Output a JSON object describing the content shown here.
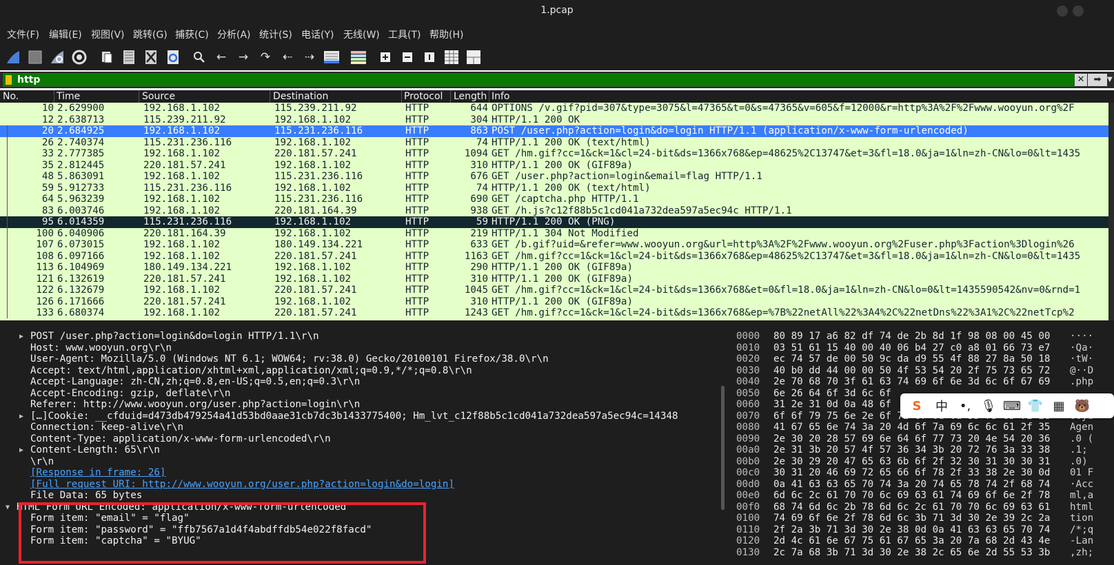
{
  "window": {
    "title": "1.pcap"
  },
  "menu": [
    "文件(F)",
    "编辑(E)",
    "视图(V)",
    "跳转(G)",
    "捕获(C)",
    "分析(A)",
    "统计(S)",
    "电话(Y)",
    "无线(W)",
    "工具(T)",
    "帮助(H)"
  ],
  "toolbar": {
    "icons": [
      "shark-fin-start-icon",
      "stop-square-icon",
      "restart-fin-icon",
      "options-gear-icon",
      "open-file-icon",
      "save-file-icon",
      "close-file-icon",
      "reload-icon",
      "search-icon",
      "back-arrow-icon",
      "forward-arrow-icon",
      "goto-packet-icon",
      "first-packet-icon",
      "last-packet-icon",
      "autoscroll-icon",
      "colorize-icon",
      "zoom-in-icon",
      "zoom-out-icon",
      "normal-size-icon",
      "resize-columns-icon",
      "layout-icon"
    ]
  },
  "filter": {
    "value": "http"
  },
  "columns": [
    "No.",
    "Time",
    "Source",
    "Destination",
    "Protocol",
    "Length",
    "Info"
  ],
  "packets": [
    {
      "no": "10",
      "time": "2.629900",
      "src": "192.168.1.102",
      "dst": "115.239.211.92",
      "proto": "HTTP",
      "len": "644",
      "info": "OPTIONS /v.gif?pid=307&type=3075&l=47365&t=0&s=47365&v=605&f=12000&r=http%3A%2F%2Fwww.wooyun.org%2F"
    },
    {
      "no": "12",
      "time": "2.638713",
      "src": "115.239.211.92",
      "dst": "192.168.1.102",
      "proto": "HTTP",
      "len": "304",
      "info": "HTTP/1.1 200 OK"
    },
    {
      "no": "20",
      "time": "2.684925",
      "src": "192.168.1.102",
      "dst": "115.231.236.116",
      "proto": "HTTP",
      "len": "863",
      "info": "POST /user.php?action=login&do=login HTTP/1.1  (application/x-www-form-urlencoded)"
    },
    {
      "no": "26",
      "time": "2.740374",
      "src": "115.231.236.116",
      "dst": "192.168.1.102",
      "proto": "HTTP",
      "len": "74",
      "info": "HTTP/1.1 200 OK  (text/html)"
    },
    {
      "no": "33",
      "time": "2.777385",
      "src": "192.168.1.102",
      "dst": "220.181.57.241",
      "proto": "HTTP",
      "len": "1094",
      "info": "GET /hm.gif?cc=1&ck=1&cl=24-bit&ds=1366x768&ep=48625%2C13747&et=3&fl=18.0&ja=1&ln=zh-CN&lo=0&lt=1435"
    },
    {
      "no": "35",
      "time": "2.812445",
      "src": "220.181.57.241",
      "dst": "192.168.1.102",
      "proto": "HTTP",
      "len": "310",
      "info": "HTTP/1.1 200 OK  (GIF89a)"
    },
    {
      "no": "48",
      "time": "5.863091",
      "src": "192.168.1.102",
      "dst": "115.231.236.116",
      "proto": "HTTP",
      "len": "676",
      "info": "GET /user.php?action=login&email=flag HTTP/1.1"
    },
    {
      "no": "59",
      "time": "5.912733",
      "src": "115.231.236.116",
      "dst": "192.168.1.102",
      "proto": "HTTP",
      "len": "74",
      "info": "HTTP/1.1 200 OK  (text/html)"
    },
    {
      "no": "64",
      "time": "5.963239",
      "src": "192.168.1.102",
      "dst": "115.231.236.116",
      "proto": "HTTP",
      "len": "690",
      "info": "GET /captcha.php HTTP/1.1"
    },
    {
      "no": "83",
      "time": "6.003746",
      "src": "192.168.1.102",
      "dst": "220.181.164.39",
      "proto": "HTTP",
      "len": "938",
      "info": "GET /h.js?c12f88b5c1cd041a732dea597a5ec94c HTTP/1.1"
    },
    {
      "no": "95",
      "time": "6.014359",
      "src": "115.231.236.116",
      "dst": "192.168.1.102",
      "proto": "HTTP",
      "len": "59",
      "info": "HTTP/1.1 200 OK  (PNG)"
    },
    {
      "no": "100",
      "time": "6.040906",
      "src": "220.181.164.39",
      "dst": "192.168.1.102",
      "proto": "HTTP",
      "len": "219",
      "info": "HTTP/1.1 304 Not Modified"
    },
    {
      "no": "107",
      "time": "6.073015",
      "src": "192.168.1.102",
      "dst": "180.149.134.221",
      "proto": "HTTP",
      "len": "633",
      "info": "GET /b.gif?uid=&refer=www.wooyun.org&url=http%3A%2F%2Fwww.wooyun.org%2Fuser.php%3Faction%3Dlogin%26"
    },
    {
      "no": "108",
      "time": "6.097166",
      "src": "192.168.1.102",
      "dst": "220.181.57.241",
      "proto": "HTTP",
      "len": "1163",
      "info": "GET /hm.gif?cc=1&ck=1&cl=24-bit&ds=1366x768&ep=48625%2C13747&et=3&fl=18.0&ja=1&ln=zh-CN&lo=0&lt=1435"
    },
    {
      "no": "113",
      "time": "6.104969",
      "src": "180.149.134.221",
      "dst": "192.168.1.102",
      "proto": "HTTP",
      "len": "290",
      "info": "HTTP/1.1 200 OK  (GIF89a)"
    },
    {
      "no": "121",
      "time": "6.132619",
      "src": "220.181.57.241",
      "dst": "192.168.1.102",
      "proto": "HTTP",
      "len": "310",
      "info": "HTTP/1.1 200 OK  (GIF89a)"
    },
    {
      "no": "122",
      "time": "6.132679",
      "src": "192.168.1.102",
      "dst": "220.181.57.241",
      "proto": "HTTP",
      "len": "1045",
      "info": "GET /hm.gif?cc=1&ck=1&cl=24-bit&ds=1366x768&et=0&fl=18.0&ja=1&ln=zh-CN&lo=0&lt=1435590542&nv=0&rnd=1"
    },
    {
      "no": "126",
      "time": "6.171666",
      "src": "220.181.57.241",
      "dst": "192.168.1.102",
      "proto": "HTTP",
      "len": "310",
      "info": "HTTP/1.1 200 OK  (GIF89a)"
    },
    {
      "no": "133",
      "time": "6.680374",
      "src": "192.168.1.102",
      "dst": "220.181.57.241",
      "proto": "HTTP",
      "len": "1243",
      "info": "GET /hm.gif?cc=1&ck=1&cl=24-bit&ds=1366x768&ep=%7B%22netAll%22%3A4%2C%22netDns%22%3A1%2C%22netTcp%2"
    }
  ],
  "selected_packet": "20",
  "details": [
    {
      "text": "POST /user.php?action=login&do=login HTTP/1.1\\r\\n",
      "expander": true,
      "link": false
    },
    {
      "text": "Host: www.wooyun.org\\r\\n",
      "expander": false,
      "link": false
    },
    {
      "text": "User-Agent: Mozilla/5.0 (Windows NT 6.1; WOW64; rv:38.0) Gecko/20100101 Firefox/38.0\\r\\n",
      "expander": false,
      "link": false
    },
    {
      "text": "Accept: text/html,application/xhtml+xml,application/xml;q=0.9,*/*;q=0.8\\r\\n",
      "expander": false,
      "link": false
    },
    {
      "text": "Accept-Language: zh-CN,zh;q=0.8,en-US;q=0.5,en;q=0.3\\r\\n",
      "expander": false,
      "link": false
    },
    {
      "text": "Accept-Encoding: gzip, deflate\\r\\n",
      "expander": false,
      "link": false
    },
    {
      "text": "Referer: http://www.wooyun.org/user.php?action=login\\r\\n",
      "expander": false,
      "link": false
    },
    {
      "text": " […]Cookie: __cfduid=d473db479254a41d53bd0aae31cb7dc3b1433775400; Hm_lvt_c12f88b5c1cd041a732dea597a5ec94c=14348",
      "expander": true,
      "link": false
    },
    {
      "text": "Connection: keep-alive\\r\\n",
      "expander": false,
      "link": false
    },
    {
      "text": "Content-Type: application/x-www-form-urlencoded\\r\\n",
      "expander": false,
      "link": false
    },
    {
      "text": "Content-Length: 65\\r\\n",
      "expander": true,
      "link": false
    },
    {
      "text": "\\r\\n",
      "expander": false,
      "link": false
    },
    {
      "text": "[Response in frame: 26]",
      "expander": false,
      "link": true
    },
    {
      "text": "[Full request URI: http://www.wooyun.org/user.php?action=login&do=login]",
      "expander": false,
      "link": true
    },
    {
      "text": "File Data: 65 bytes",
      "expander": false,
      "link": false
    }
  ],
  "form_section": {
    "title": "HTML Form URL Encoded: application/x-www-form-urlencoded",
    "items": [
      "Form item: \"email\" = \"flag\"",
      "Form item: \"password\" = \"ffb7567a1d4f4abdffdb54e022f8facd\"",
      "Form item: \"captcha\" = \"BYUG\""
    ]
  },
  "hex": [
    {
      "off": "0000",
      "hex": "80 89 17 a6 82 df 74 de  2b 8d 1f 98 08 00 45 00",
      "ascii": "····"
    },
    {
      "off": "0010",
      "hex": "03 51 61 15 40 00 40 06  b4 27 c0 a8 01 66 73 e7",
      "ascii": "·Qa·"
    },
    {
      "off": "0020",
      "hex": "ec 74 57 de 00 50 9c da  d9 55 4f 88 27 8a 50 18",
      "ascii": "·tW·"
    },
    {
      "off": "0030",
      "hex": "40 b0 dd 44 00 00 50 4f  53 54 20 2f 75 73 65 72",
      "ascii": "@··D"
    },
    {
      "off": "0040",
      "hex": "2e 70 68 70 3f 61 63 74  69 6f 6e 3d 6c 6f 67 69",
      "ascii": ".php"
    },
    {
      "off": "0050",
      "hex": "6e 26 64 6f 3d 6c 6f",
      "ascii": ""
    },
    {
      "off": "0060",
      "hex": "31 2e 31 0d 0a 48 6f",
      "ascii": ""
    },
    {
      "off": "0070",
      "hex": "6f 6f 79 75 6e 2e 6f 72  67 0d 0a 55 73 65 72 2d",
      "ascii": "ooyu"
    },
    {
      "off": "0080",
      "hex": "41 67 65 6e 74 3a 20 4d  6f 7a 69 6c 6c 61 2f 35",
      "ascii": "Agen"
    },
    {
      "off": "0090",
      "hex": "2e 30 20 28 57 69 6e 64  6f 77 73 20 4e 54 20 36",
      "ascii": ".0 ("
    },
    {
      "off": "00a0",
      "hex": "2e 31 3b 20 57 4f 57 36  34 3b 20 72 76 3a 33 38",
      "ascii": ".1; "
    },
    {
      "off": "00b0",
      "hex": "2e 30 29 20 47 65 63 6b  6f 2f 32 30 31 30 30 31",
      "ascii": ".0) "
    },
    {
      "off": "00c0",
      "hex": "30 31 20 46 69 72 65 66  6f 78 2f 33 38 2e 30 0d",
      "ascii": "01 F"
    },
    {
      "off": "00d0",
      "hex": "0a 41 63 63 65 70 74 3a  20 74 65 78 74 2f 68 74",
      "ascii": "·Acc"
    },
    {
      "off": "00e0",
      "hex": "6d 6c 2c 61 70 70 6c 69  63 61 74 69 6f 6e 2f 78",
      "ascii": "ml,a"
    },
    {
      "off": "00f0",
      "hex": "68 74 6d 6c 2b 78 6d 6c  2c 61 70 70 6c 69 63 61",
      "ascii": "html"
    },
    {
      "off": "0100",
      "hex": "74 69 6f 6e 2f 78 6d 6c  3b 71 3d 30 2e 39 2c 2a",
      "ascii": "tion"
    },
    {
      "off": "0110",
      "hex": "2f 2a 3b 71 3d 30 2e 38  0d 0a 41 63 63 65 70 74",
      "ascii": "/*;q"
    },
    {
      "off": "0120",
      "hex": "2d 4c 61 6e 67 75 61 67  65 3a 20 7a 68 2d 43 4e",
      "ascii": "-Lan"
    },
    {
      "off": "0130",
      "hex": "2c 7a 68 3b 71 3d 30 2e  38 2c 65 6e 2d 55 53 3b",
      "ascii": ",zh;"
    }
  ],
  "colors": {
    "http_row": "#e4ffc7",
    "selected_row": "#3a7dfc",
    "marked_row": "#12272e",
    "filter_valid": "#0a7a00",
    "highlight": "#e8232e"
  }
}
